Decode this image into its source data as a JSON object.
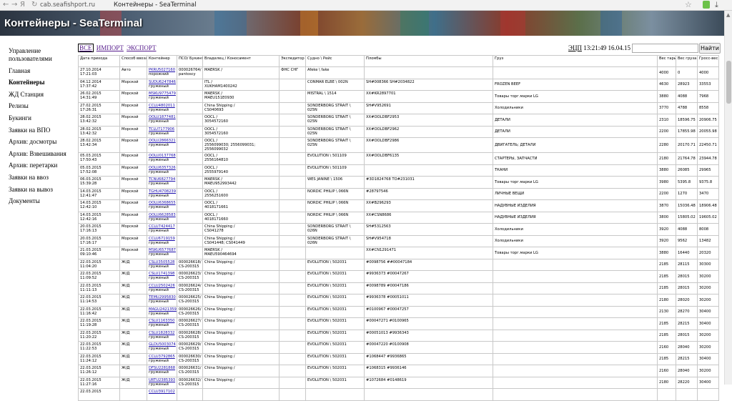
{
  "browser": {
    "url": "cab.seafishport.ru",
    "title": "Контейнеры - SeaTerminal"
  },
  "banner": {
    "title": "Контейнеры - SeaTerminal"
  },
  "sidebar": {
    "items": [
      {
        "label": "Управление пользователями",
        "active": false
      },
      {
        "label": "Главная",
        "active": false
      },
      {
        "label": "Контейнеры",
        "active": true
      },
      {
        "label": "ЖД Станция",
        "active": false
      },
      {
        "label": "Релизы",
        "active": false
      },
      {
        "label": "Букинги",
        "active": false
      },
      {
        "label": "Заявки на ВПО",
        "active": false
      },
      {
        "label": "Архив: досмотры",
        "active": false
      },
      {
        "label": "Архив: Взвешивания",
        "active": false
      },
      {
        "label": "Архив: перетарки",
        "active": false
      },
      {
        "label": "Заявки на ввоз",
        "active": false
      },
      {
        "label": "Заявки на вывоз",
        "active": false
      },
      {
        "label": "Документы",
        "active": false
      }
    ]
  },
  "filters": {
    "all": "ВСЕ",
    "import": "ИМПОРТ",
    "export": "ЭКСПОРТ"
  },
  "status": {
    "ecp": "ЭЦП",
    "time": "13:21:49 16.04.15"
  },
  "search": {
    "button": "Найти",
    "value": ""
  },
  "table": {
    "headers": [
      "Дата прихода",
      "Способ ввоза",
      "Контейнер",
      "ПСО/ Букинг",
      "Владелец / Коносамент",
      "Экспедитор",
      "Судно \\ Рейс",
      "Пломбы",
      "Груз",
      "Вес тары",
      "Вес груза",
      "Гросс-вес"
    ],
    "rows": [
      [
        "27.10.2014\n17:21:03",
        "Авто",
        "PKRU5027160\nпорожний",
        "000026764/\npantoscy",
        "MAERSK /",
        "ФНС СНГ",
        "Afeke \\ fake",
        "",
        "",
        "4000",
        "0",
        "4000"
      ],
      [
        "04.12.2014\n17:37:42",
        "Морской",
        "SUDU6247846\nгруженый",
        "",
        "ITL /\nXUKHAM1400242",
        "",
        "CONMAR ELBE \\ 002N",
        "SH#008366 SH#2034822",
        "FROZEN BEEF",
        "4630",
        "28923",
        "33553"
      ],
      [
        "26.02.2015\n14:31:49",
        "Морской",
        "MSKU9775479\nгруженый",
        "",
        "MAERSK /\nMAEU151E0930",
        "",
        "MISTRAL \\ 1514",
        "XX#KR2897701",
        "Товары торг.марки LG",
        "3880",
        "4088",
        "7968"
      ],
      [
        "27.02.2015\n17:26:31",
        "Морской",
        "CCLU4802011\nгруженый",
        "",
        "China Shipping /\nCS040693",
        "",
        "SONDERBORG STRAIT \\\n025N",
        "SH#V952691",
        "Холодильники",
        "3770",
        "4788",
        "8558"
      ],
      [
        "28.02.2015\n13:42:32",
        "Морской",
        "OOLU1877481\nгруженый",
        "",
        "OOCL /\n3054572160",
        "",
        "SONDERBORG STRAIT \\\n025N",
        "XX#OOLDBF2953",
        "ДЕТАЛИ",
        "2310",
        "18596.75",
        "20906.75"
      ],
      [
        "28.02.2015\n13:42:32",
        "Морской",
        "TCLU7177906\nгруженый",
        "",
        "OOCL /\n3054572160",
        "",
        "SONDERBORG STRAIT \\\n025N",
        "XX#OOLDBF2962",
        "ДЕТАЛИ",
        "2200",
        "17855.98",
        "20055.98"
      ],
      [
        "28.02.2015\n13:42:34",
        "Морской",
        "OOLU2866321\nгруженый",
        "",
        "OOCL /\n2556099030; 2556099031;\n2556099032",
        "",
        "SONDERBORG STRAIT \\\n025N",
        "XX#OOLDBF2986",
        "ДВИГАТЕЛЬ; ДЕТАЛИ",
        "2280",
        "20170.71",
        "22450.71"
      ],
      [
        "05.03.2015\n17:50:43",
        "Морской",
        "OOLU0137768\nгруженый",
        "",
        "OOCL /\n2556164810",
        "",
        "EVOLUTION \\ 501109",
        "XX#OOLDBF6135",
        "СТАРТЕРЫ, ЗАПЧАСТИ",
        "2180",
        "21764.78",
        "23944.78"
      ],
      [
        "05.03.2015\n17:52:08",
        "Морской",
        "OOLU6357326\nгруженый",
        "",
        "OOCL /\n2555979140",
        "",
        "EVOLUTION \\ 501109",
        "",
        "ТКАНИ",
        "3880",
        "26085",
        "29965"
      ],
      [
        "06.03.2015\n15:39:28",
        "Морской",
        "TCNU6827794\nгруженый",
        "",
        "MAERSK /\nMAEU952993442",
        "",
        "WES JANINE \\ 1506",
        "#3D1824768 TO#231031",
        "Товары торг.марки LG",
        "3980",
        "5395.8",
        "9375.8"
      ],
      [
        "14.03.2015\n12:41:47",
        "Морской",
        "TGHU4708239\nгруженый",
        "",
        "OOCL /\n2556251600",
        "",
        "NORDIC PHILIP \\ 066N",
        "#28797546",
        "ЛИЧНЫЕ ВЕЩИ",
        "2200",
        "1270",
        "3470"
      ],
      [
        "14.03.2015\n12:42:10",
        "Морской",
        "OOLU6368655\nгруженый",
        "",
        "OOCL /\n4018171661",
        "",
        "NORDIC PHILIP \\ 066N",
        "XX#B296293",
        "НАДУВНЫЕ ИЗДЕЛИЯ",
        "3870",
        "15036.48",
        "18906.48"
      ],
      [
        "14.03.2015\n12:42:16",
        "Морской",
        "OOLU6628583\nгруженый",
        "",
        "OOCL /\n4018171660",
        "",
        "NORDIC PHILIP \\ 066N",
        "XX#CSN8686",
        "НАДУВНЫЕ ИЗДЕЛИЯ",
        "3800",
        "15805.02",
        "19605.02"
      ],
      [
        "20.03.2015\n17:16:13",
        "Морской",
        "CCLU7424417\nгруженый",
        "",
        "China Shipping /\nCS041278",
        "",
        "SONDERBORG STRAIT \\\n026N",
        "SH#5312563",
        "Холодильники",
        "3920",
        "4088",
        "8008"
      ],
      [
        "20.03.2015\n17:16:17",
        "Морской",
        "CCLU6719159\nгруженый",
        "",
        "China Shipping /\nCS041448; CS041449",
        "",
        "SONDERBORG STRAIT \\\n026N",
        "SH#V954718",
        "Холодильники",
        "3920",
        "9562",
        "13482"
      ],
      [
        "21.03.2015\n09:10:46",
        "Морской",
        "MSKU6577687\nгруженый",
        "",
        "MAERSK /\nMAEU590464694",
        "",
        "",
        "XX#CN1291471",
        "Товары торг.марки LG",
        "3880",
        "16440",
        "20320"
      ],
      [
        "22.03.2015\n11:04:20",
        "Ж/Д",
        "CSLU3505528\nгруженый",
        "000026618/\nCS-200315",
        "China Shipping /",
        "",
        "EVOLUTION \\ 502031",
        "#0098756 ##00047184",
        "",
        "2185",
        "28115",
        "30300"
      ],
      [
        "22.03.2015\n11:09:52",
        "Ж/Д",
        "CSLU1741398\nгруженый",
        "000026623/\nCS-200315",
        "China Shipping /",
        "",
        "EVOLUTION \\ 502031",
        "#9936373 #00047267",
        "",
        "2185",
        "28015",
        "30200"
      ],
      [
        "22.03.2015\n11:11:13",
        "Ж/Д",
        "CCLU2502426\nгруженый",
        "000026624/\nCS-200315",
        "China Shipping /",
        "",
        "EVOLUTION \\ 502031",
        "#0098789 #00047186",
        "",
        "2185",
        "28015",
        "30200"
      ],
      [
        "22.03.2015\n11:14:53",
        "Ж/Д",
        "TEMU2995830\nгруженый",
        "000026625/\nCS-200315",
        "China Shipping /",
        "",
        "EVOLUTION \\ 502031",
        "#9936378 #00051011",
        "",
        "2180",
        "28020",
        "30200"
      ],
      [
        "22.03.2015\n11:16:42",
        "Ж/Д",
        "MAGU2421359\nгруженый",
        "000026626/\nCS-200315",
        "China Shipping /",
        "",
        "EVOLUTION \\ 502031",
        "#0100967 #00047257",
        "",
        "2130",
        "28270",
        "30400"
      ],
      [
        "22.03.2015\n11:19:28",
        "Ж/Д",
        "CSLU1163350\nгруженый",
        "000026627/\nCS-200315",
        "China Shipping /",
        "",
        "EVOLUTION \\ 502031",
        "#00047271 #0100965",
        "",
        "2185",
        "28215",
        "30400"
      ],
      [
        "22.03.2015\n11:20:22",
        "Ж/Д",
        "CSLU1828332\nгруженый",
        "000026628/\nCS-200315",
        "China Shipping /",
        "",
        "EVOLUTION \\ 502031",
        "#00051013 #9936343",
        "",
        "2185",
        "28015",
        "30200"
      ],
      [
        "22.03.2015\n11:22:53",
        "Ж/Д",
        "GLDU5003074\nгруженый",
        "000026629/\nCS-200315",
        "China Shipping /",
        "",
        "EVOLUTION \\ 502031",
        "#00047220 #0100908",
        "",
        "2160",
        "28040",
        "30200"
      ],
      [
        "22.03.2015\n11:24:12",
        "Ж/Д",
        "CCLU3792865\nгруженый",
        "000026630/\nCS-200315",
        "China Shipping /",
        "",
        "EVOLUTION \\ 502031",
        "#1068447 #9936865",
        "",
        "2185",
        "28215",
        "30400"
      ],
      [
        "22.03.2015\n11:26:12",
        "Ж/Д",
        "DFSU2281868\nгруженый",
        "000026631/\nCS-200315",
        "China Shipping /",
        "",
        "EVOLUTION \\ 502031",
        "#1068315 #9936146",
        "",
        "2160",
        "28040",
        "30200"
      ],
      [
        "22.03.2015\n11:27:16",
        "Ж/Д",
        "URTU2385393\nгруженый",
        "000026632/\nCS-200315",
        "China Shipping /",
        "",
        "EVOLUTION \\ 502031",
        "#1072684 #0148619",
        "",
        "2180",
        "28220",
        "30400"
      ],
      [
        "22.03.2015",
        "",
        "CCLU3917102",
        "",
        "",
        "",
        "",
        "",
        "",
        "",
        "",
        ""
      ]
    ]
  }
}
